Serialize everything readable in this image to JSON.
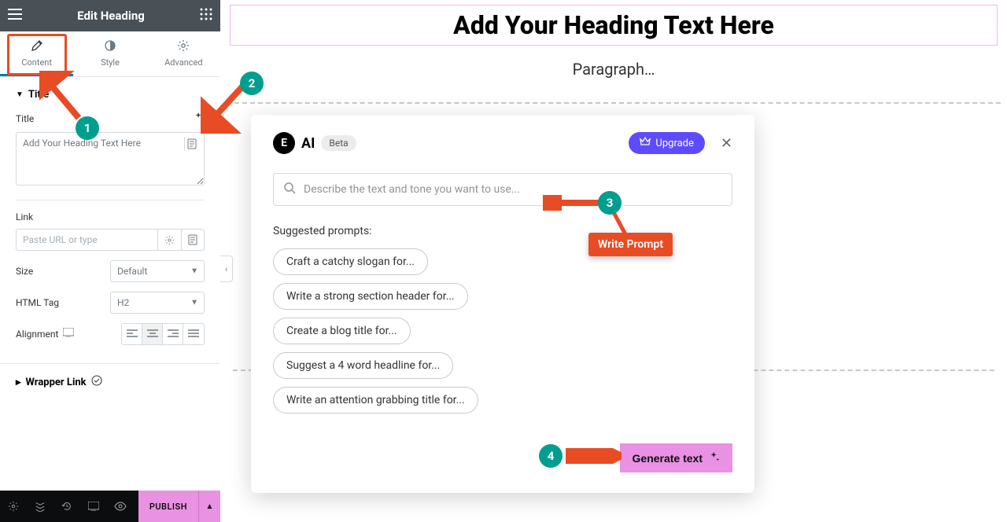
{
  "sidebar": {
    "title": "Edit Heading",
    "tabs": [
      {
        "label": "Content",
        "icon": "pencil"
      },
      {
        "label": "Style",
        "icon": "half-circle"
      },
      {
        "label": "Advanced",
        "icon": "gear"
      }
    ],
    "section_title": "Title",
    "title_field_label": "Title",
    "title_field_value": "Add Your Heading Text Here",
    "link_label": "Link",
    "link_placeholder": "Paste URL or type",
    "size_label": "Size",
    "size_value": "Default",
    "htmltag_label": "HTML Tag",
    "htmltag_value": "H2",
    "alignment_label": "Alignment",
    "wrapper_label": "Wrapper Link"
  },
  "bottom_bar": {
    "publish": "PUBLISH"
  },
  "canvas": {
    "heading": "Add Your Heading Text Here",
    "paragraph": "Paragraph…"
  },
  "modal": {
    "ai_label": "AI",
    "beta": "Beta",
    "upgrade": "Upgrade",
    "prompt_placeholder": "Describe the text and tone you want to use...",
    "suggested_label": "Suggested prompts:",
    "prompts": [
      "Craft a catchy slogan for...",
      "Write a strong section header for...",
      "Create a blog title for...",
      "Suggest a 4 word headline for...",
      "Write an attention grabbing title for..."
    ],
    "generate": "Generate text"
  },
  "annotations": {
    "tooltip": "Write Prompt",
    "steps": [
      "1",
      "2",
      "3",
      "4"
    ]
  }
}
